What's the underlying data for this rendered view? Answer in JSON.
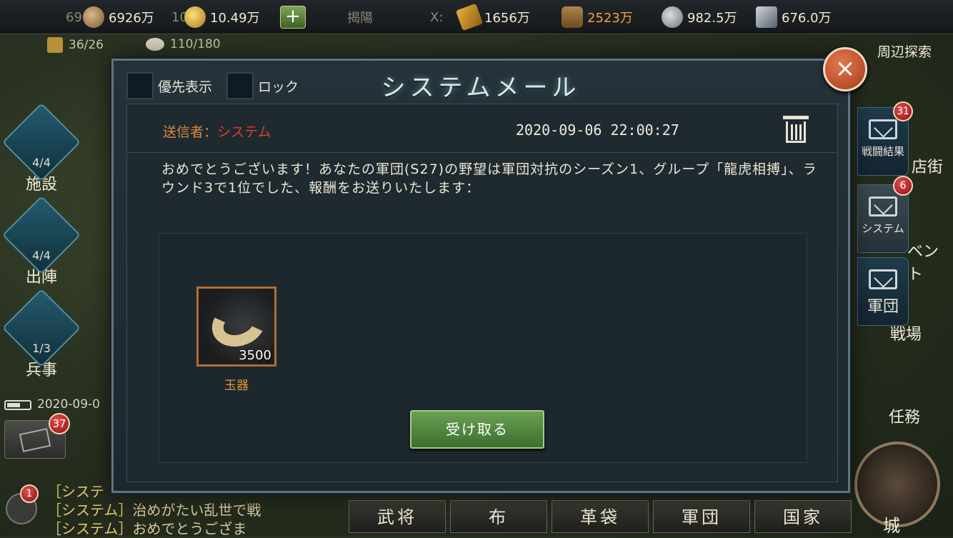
{
  "topbar": {
    "coins": "6926万",
    "gold": "10.49万",
    "location": "揭陽",
    "coord_prefix": "X:",
    "grain": "1656万",
    "wood": "2523万",
    "stone": "982.5万",
    "iron": "676.0万",
    "plus": "+",
    "partial_left": "69",
    "partial_mid": "10"
  },
  "subinfo": {
    "troops": "36/26",
    "capacity": "110/180"
  },
  "leftnav": [
    {
      "count": "4/4",
      "label": "施設"
    },
    {
      "count": "4/4",
      "label": "出陣"
    },
    {
      "count": "1/3",
      "label": "兵事"
    }
  ],
  "left_status": {
    "date": "2020-09-0",
    "mail_badge": "37",
    "chat_badge": "1"
  },
  "chat": [
    {
      "tag": "［システ",
      "text": ""
    },
    {
      "tag": "［システム］",
      "text": "治めがたい乱世で戦"
    },
    {
      "tag": "［システム］",
      "text": "おめでとうござま"
    }
  ],
  "bottomnav": [
    "武将",
    "布",
    "革袋",
    "軍団",
    "国家"
  ],
  "right": {
    "explore": "周辺探索",
    "tabs": [
      {
        "label": "戦闘結果",
        "badge": "31"
      },
      {
        "label": "システム",
        "badge": "6"
      },
      {
        "label": "軍団",
        "badge": ""
      }
    ],
    "shop": "店街",
    "event": "ベント",
    "battlefield": "戦場",
    "mission": "任務",
    "city": "城"
  },
  "modal": {
    "title": "システムメール",
    "priority_label": "優先表示",
    "lock_label": "ロック",
    "close": "×",
    "sender_label": "送信者：",
    "sender_name": "システム",
    "datetime": "2020-09-06 22:00:27",
    "body": "おめでとうございます！あなたの軍団(S27)の野望は軍団対抗のシーズン1、グループ「龍虎相搏」、ラウンド3で1位でした、報酬をお送りいたします：",
    "reward": {
      "count": "3500",
      "name": "玉器"
    },
    "receive_button": "受け取る"
  }
}
